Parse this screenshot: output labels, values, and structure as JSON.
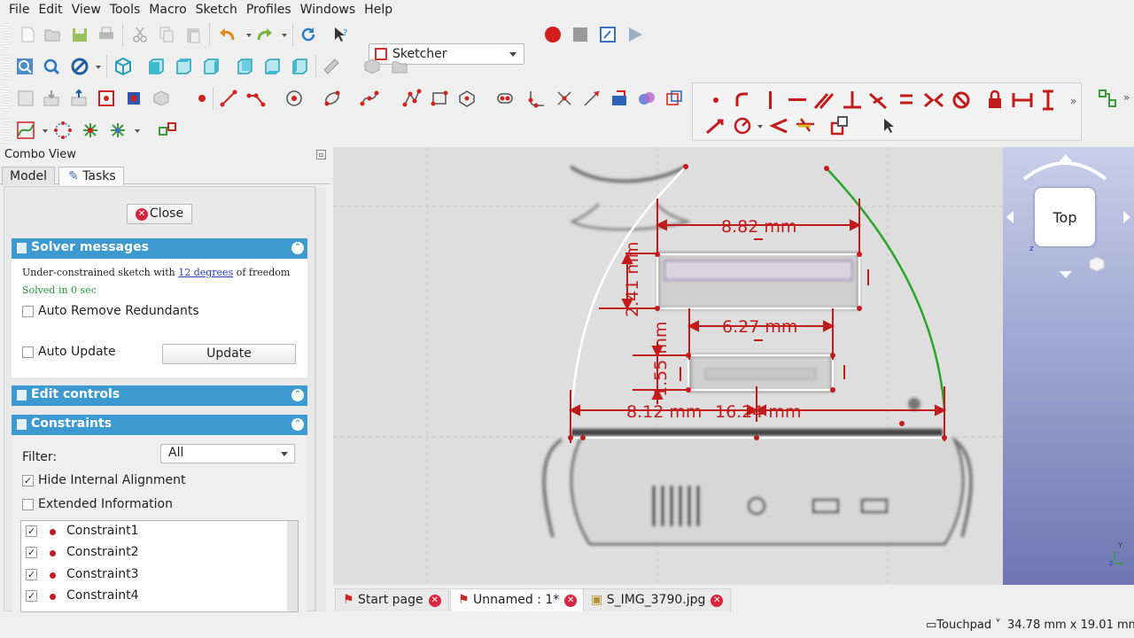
{
  "menu": [
    "File",
    "Edit",
    "View",
    "Tools",
    "Macro",
    "Sketch",
    "Profiles",
    "Windows",
    "Help"
  ],
  "workbench": "Sketcher",
  "combo": {
    "title": "Combo View",
    "tabs": [
      "Model",
      "Tasks"
    ],
    "close_label": "Close",
    "solver": {
      "header": "Solver messages",
      "msg_prefix": "Under-constrained sketch with ",
      "msg_link": "12 degrees",
      "msg_suffix": " of freedom",
      "solved": "Solved in 0 sec",
      "auto_remove": "Auto Remove Redundants",
      "auto_update": "Auto Update",
      "update_button": "Update"
    },
    "edit_controls": {
      "header": "Edit controls"
    },
    "constraints": {
      "header": "Constraints",
      "filter_label": "Filter:",
      "filter_value": "All",
      "hide_internal": "Hide Internal Alignment",
      "extended_info": "Extended Information",
      "items": [
        "Constraint1",
        "Constraint2",
        "Constraint3",
        "Constraint4"
      ]
    }
  },
  "viewport": {
    "dimensions": [
      "8.82 mm",
      "6.27 mm",
      "8.12 mm",
      "16.24 mm",
      "2.41 mm",
      "1.55 mm"
    ],
    "nav_cube_face": "Top",
    "axis_z": "z",
    "axis_y": "Y"
  },
  "doc_tabs": [
    "Start page",
    "Unnamed : 1*",
    "S_IMG_3790.jpg"
  ],
  "status": {
    "nav_style": "Touchpad",
    "dimensions": "34.78 mm x 19.01 mm"
  },
  "colors": {
    "accent": "#3d9ad1",
    "constraint": "#c21b1b",
    "selected": "#2aa52a"
  }
}
